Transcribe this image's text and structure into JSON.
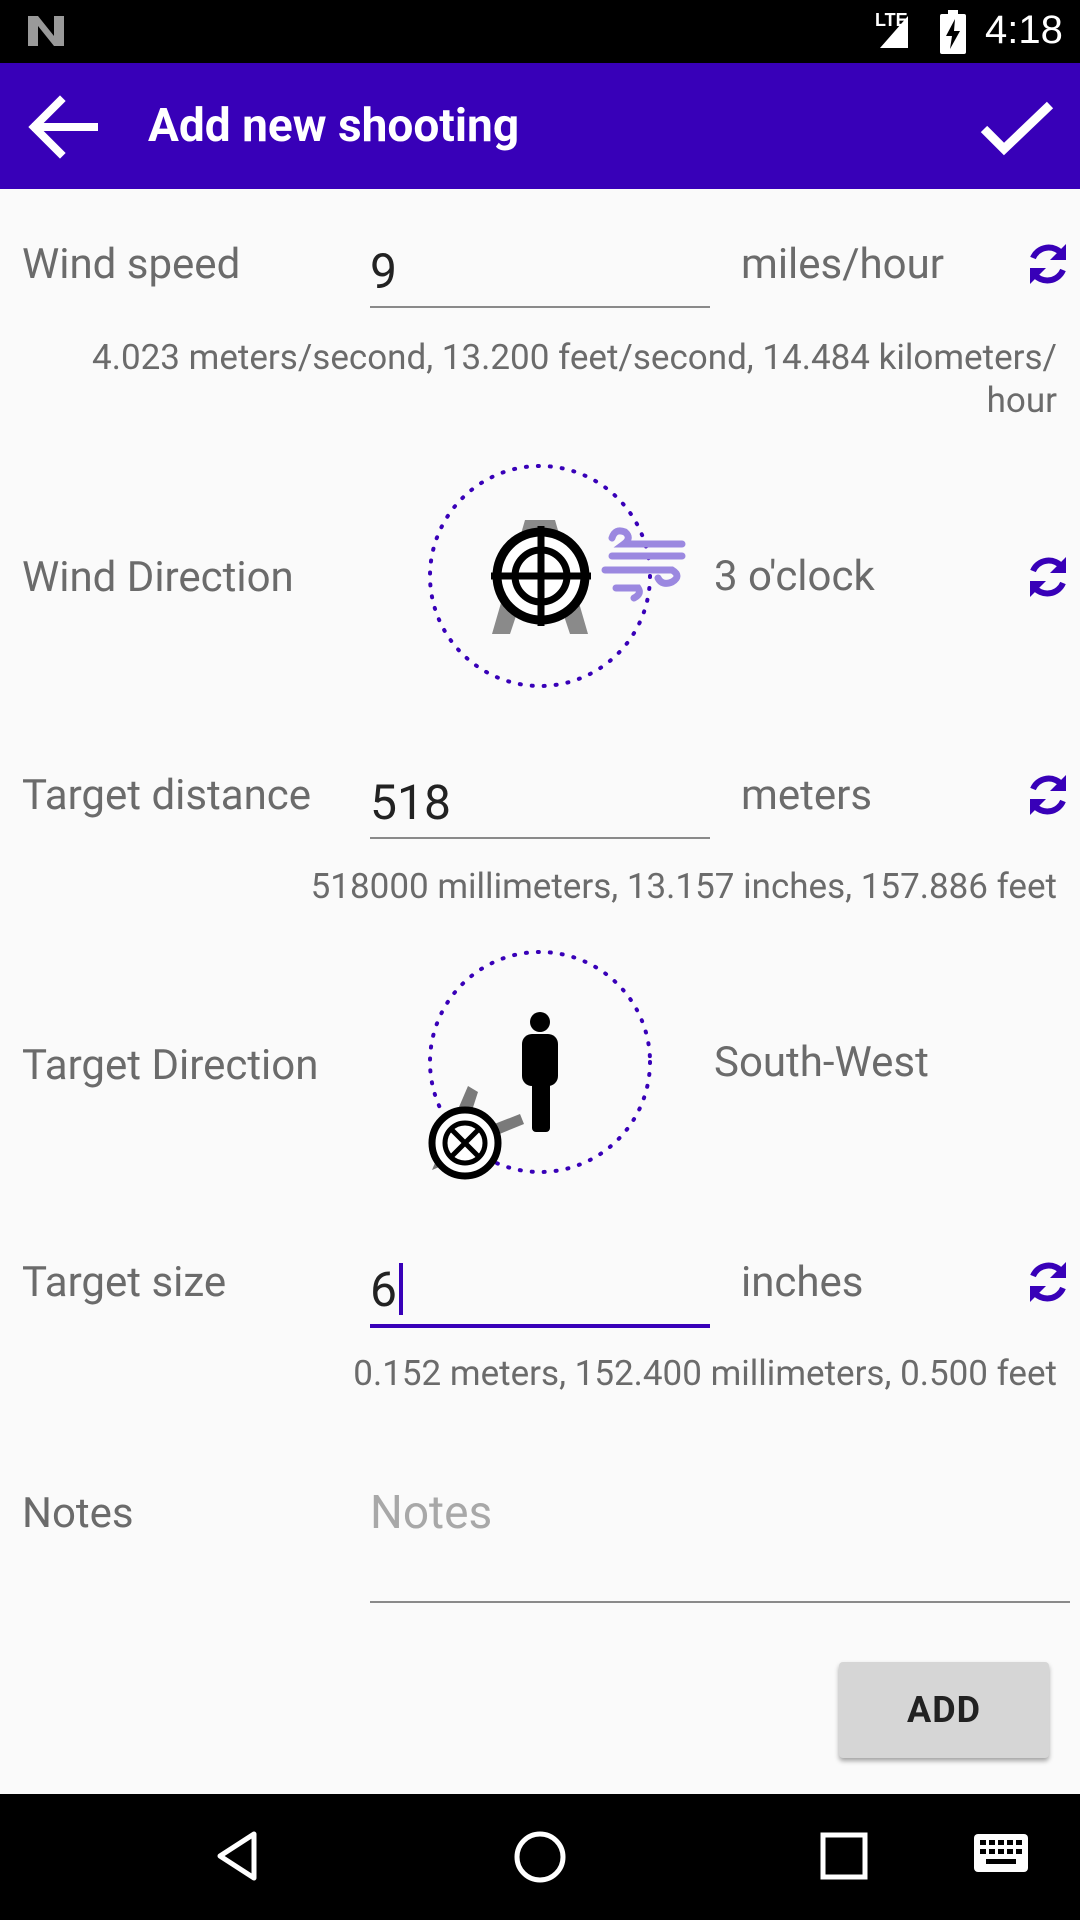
{
  "status_bar": {
    "time": "4:18",
    "network_label": "LTE"
  },
  "app_bar": {
    "title": "Add new shooting"
  },
  "wind_speed": {
    "label": "Wind speed",
    "value": "9",
    "unit": "miles/hour",
    "conversions": "4.023 meters/second, 13.200 feet/second, 14.484 kilometers/ hour"
  },
  "wind_direction": {
    "label": "Wind Direction",
    "value": "3 o'clock"
  },
  "target_distance": {
    "label": "Target distance",
    "value": "518",
    "unit": "meters",
    "conversions": "518000 millimeters, 13.157 inches, 157.886 feet"
  },
  "target_direction": {
    "label": "Target Direction",
    "value": "South-West"
  },
  "target_size": {
    "label": "Target size",
    "value": "6",
    "unit": "inches",
    "conversions": "0.152 meters, 152.400 millimeters, 0.500 feet"
  },
  "notes": {
    "label": "Notes",
    "placeholder": "Notes"
  },
  "add_button": {
    "label": "ADD"
  },
  "colors": {
    "primary": "#3800b8",
    "wind_icon": "#9b88e0",
    "text_secondary": "#6b6b6b"
  }
}
